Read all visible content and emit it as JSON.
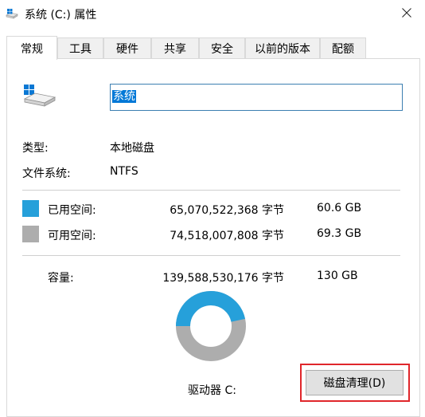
{
  "window": {
    "title": "系统 (C:) 属性"
  },
  "tabs": [
    {
      "label": "常规"
    },
    {
      "label": "工具"
    },
    {
      "label": "硬件"
    },
    {
      "label": "共享"
    },
    {
      "label": "安全"
    },
    {
      "label": "以前的版本"
    },
    {
      "label": "配额"
    }
  ],
  "active_tab": "常规",
  "drive": {
    "name_value": "系统",
    "type_label": "类型:",
    "type_value": "本地磁盘",
    "fs_label": "文件系统:",
    "fs_value": "NTFS"
  },
  "space": {
    "used": {
      "label": "已用空间:",
      "bytes": "65,070,522,368 字节",
      "size": "60.6 GB",
      "color": "#26a0da"
    },
    "free": {
      "label": "可用空间:",
      "bytes": "74,518,007,808 字节",
      "size": "69.3 GB",
      "color": "#adadad"
    },
    "capacity": {
      "label": "容量:",
      "bytes": "139,588,530,176 字节",
      "size": "130 GB"
    },
    "used_fraction": 0.466
  },
  "drive_letter_label": "驱动器 C:",
  "cleanup_button_label": "磁盘清理(D)",
  "icons": {
    "title": "drive-icon",
    "close": "close-icon",
    "drive": "hard-drive-icon"
  }
}
